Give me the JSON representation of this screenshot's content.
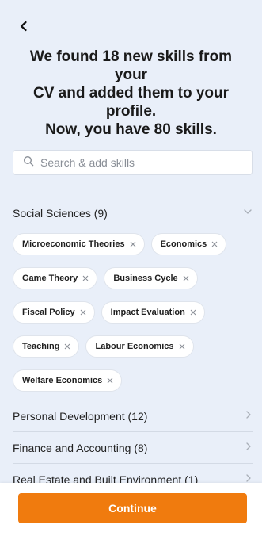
{
  "header": {
    "back_icon": "chevron-left-icon",
    "headline_lines": [
      "We found 18 new skills from your",
      "CV and added them to your",
      "profile.",
      "Now, you have 80 skills."
    ]
  },
  "search": {
    "placeholder": "Search & add skills",
    "value": "",
    "icon": "search-icon"
  },
  "open_category": {
    "label": "Social Sciences (9)",
    "expanded": true,
    "skills": [
      "Microeconomic Theories",
      "Economics",
      "Game Theory",
      "Business Cycle",
      "Fiscal Policy",
      "Impact Evaluation",
      "Teaching",
      "Labour Economics",
      "Welfare Economics"
    ]
  },
  "collapsed_categories": [
    {
      "label": "Personal Development (12)"
    },
    {
      "label": "Finance and Accounting (8)"
    },
    {
      "label": "Real Estate and Built Environment (1)"
    }
  ],
  "footer": {
    "continue_label": "Continue"
  },
  "colors": {
    "background": "#e9eff9",
    "accent": "#f07b0e",
    "chip_bg": "#ffffff"
  }
}
